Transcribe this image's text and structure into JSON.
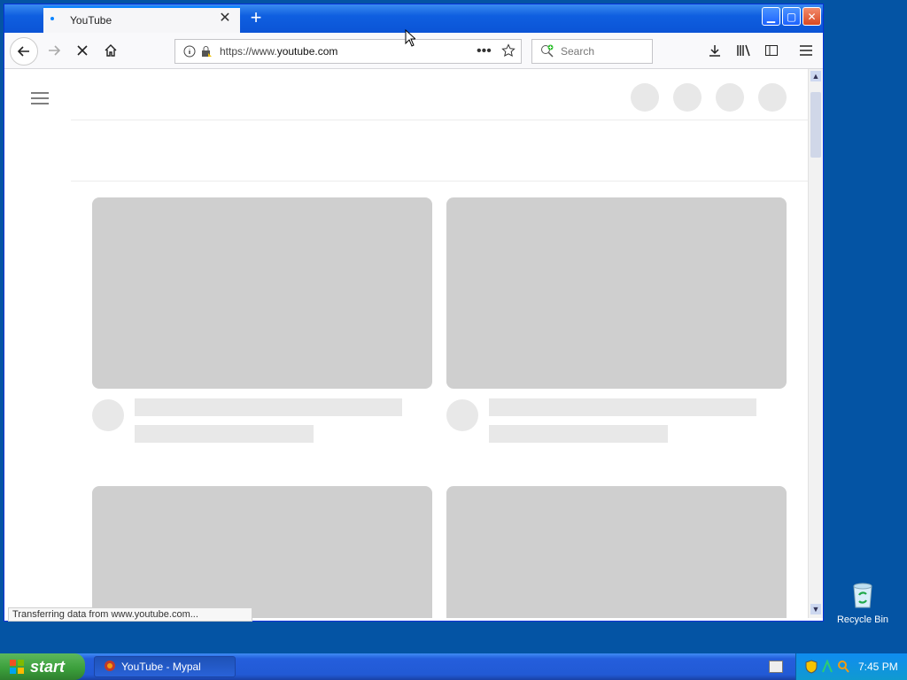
{
  "browser": {
    "tab_title": "YouTube",
    "url_prefix": "https://www.",
    "url_domain": "youtube.com",
    "search_placeholder": "Search",
    "status_text": "Transferring data from www.youtube.com..."
  },
  "desktop": {
    "recycle_bin_label": "Recycle Bin"
  },
  "taskbar": {
    "start_label": "start",
    "task_label": "YouTube - Mypal",
    "time": "7:45 PM"
  },
  "icons": {
    "back": "back-arrow-icon",
    "forward": "forward-arrow-icon",
    "stop": "stop-icon",
    "home": "home-icon",
    "info": "info-icon",
    "lock": "lock-icon",
    "more": "more-icon",
    "bookmark": "star-icon",
    "download": "download-icon",
    "library": "library-icon",
    "sidebar": "sidebar-icon",
    "menu": "hamburger-icon"
  },
  "colors": {
    "accent": "#0a84ff",
    "skeleton": "#cfcfcf",
    "skeleton_light": "#e8e8e8",
    "desktop": "#0454a4"
  }
}
